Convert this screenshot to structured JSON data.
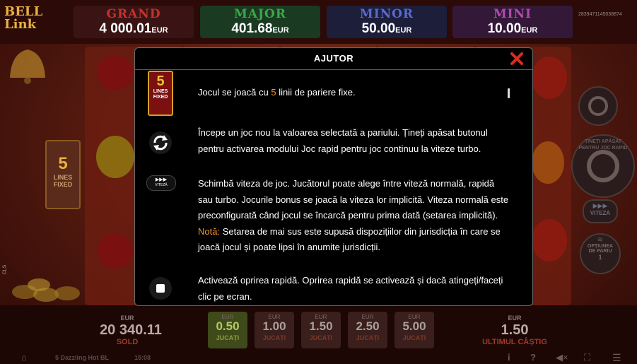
{
  "game": {
    "logo": "BELL Link",
    "id_text": "2839471145038874",
    "jackpots": [
      {
        "name": "GRAND",
        "amount": "4 000.01",
        "currency": "EUR"
      },
      {
        "name": "MAJOR",
        "amount": "401.68",
        "currency": "EUR"
      },
      {
        "name": "MINOR",
        "amount": "50.00",
        "currency": "EUR"
      },
      {
        "name": "MINI",
        "amount": "10.00",
        "currency": "EUR"
      }
    ],
    "lines_badge": {
      "number": "5",
      "line1": "LINES",
      "line2": "FIXED"
    },
    "side": {
      "hold_text": "ȚINEȚI APĂSAT PENTRU JOC RAPID",
      "speed_label": "VITEZA",
      "bet_option_line1": "OPȚIUNEA",
      "bet_option_line2": "DE PARIU",
      "bet_option_value": "1"
    },
    "left_vertical_text": "CLS",
    "balance": {
      "currency": "EUR",
      "value": "20 340.11",
      "label": "SOLD"
    },
    "bets": [
      {
        "currency": "EUR",
        "value": "0.50",
        "label": "JUCAȚI",
        "selected": true
      },
      {
        "currency": "EUR",
        "value": "1.00",
        "label": "JUCAȚI",
        "selected": false
      },
      {
        "currency": "EUR",
        "value": "1.50",
        "label": "JUCAȚI",
        "selected": false
      },
      {
        "currency": "EUR",
        "value": "2.50",
        "label": "JUCAȚI",
        "selected": false
      },
      {
        "currency": "EUR",
        "value": "5.00",
        "label": "JUCAȚI",
        "selected": false
      }
    ],
    "last_win": {
      "currency": "EUR",
      "value": "1.50",
      "label": "ULTIMUL CÂȘTIG"
    },
    "footer": {
      "game_name": "5 Dazzling Hot BL",
      "time": "15:08"
    }
  },
  "help": {
    "title": "AJUTOR",
    "badge": {
      "number": "5",
      "line1": "LINES",
      "line2": "FIXED"
    },
    "speed_icon_label": "VITEZĂ",
    "item1": {
      "pre": "Jocul se joacă cu ",
      "highlight": "5",
      "post": " linii de pariere fixe."
    },
    "item2": "Începe un joc nou la valoarea selectată a pariului. Țineți apăsat butonul pentru activarea modului Joc rapid pentru joc continuu la viteze turbo.",
    "item3": "Schimbă viteza de joc. Jucătorul poate alege între viteză normală, rapidă sau turbo. Jocurile bonus se joacă la viteza lor implicită. Viteza normală este preconfigurată când jocul se încarcă pentru prima dată (setarea implicită).",
    "item3_note_label": "Notă:",
    "item3_note": " Setarea de mai sus este supusă dispozițiilor din jurisdicția în care se joacă jocul și poate lipsi în anumite jurisdicții.",
    "item4": "Activează oprirea rapidă. Oprirea rapidă se activează și dacă atingeți/faceți clic pe ecran."
  },
  "colors": {
    "accent_orange": "#f0932e",
    "close_red": "#e02a1a",
    "grand": "#c8302a",
    "major": "#3aa84a",
    "minor": "#5a6ad0",
    "mini": "#b04ab0"
  }
}
